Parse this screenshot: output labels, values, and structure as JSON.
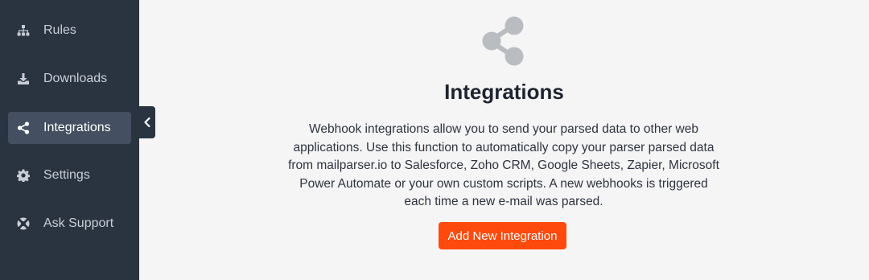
{
  "sidebar": {
    "items": [
      {
        "label": "Rules",
        "icon": "sitemap-icon"
      },
      {
        "label": "Downloads",
        "icon": "download-icon"
      },
      {
        "label": "Integrations",
        "icon": "share-icon",
        "active": true
      },
      {
        "label": "Settings",
        "icon": "gear-icon"
      },
      {
        "label": "Ask Support",
        "icon": "lifebuoy-icon"
      }
    ]
  },
  "main": {
    "icon": "share-icon",
    "title": "Integrations",
    "description": "Webhook integrations allow you to send your parsed data to other web applications. Use this function to automatically copy your parser parsed data from mailparser.io to Salesforce, Zoho CRM, Google Sheets, Zapier, Microsoft Power Automate or your own custom scripts. A new webhooks is triggered each time a new e-mail was parsed.",
    "button_label": "Add New Integration"
  },
  "colors": {
    "sidebar_bg": "#2a3441",
    "active_item_bg": "#445061",
    "accent": "#ff4a0d",
    "background": "#f5f5f5"
  }
}
